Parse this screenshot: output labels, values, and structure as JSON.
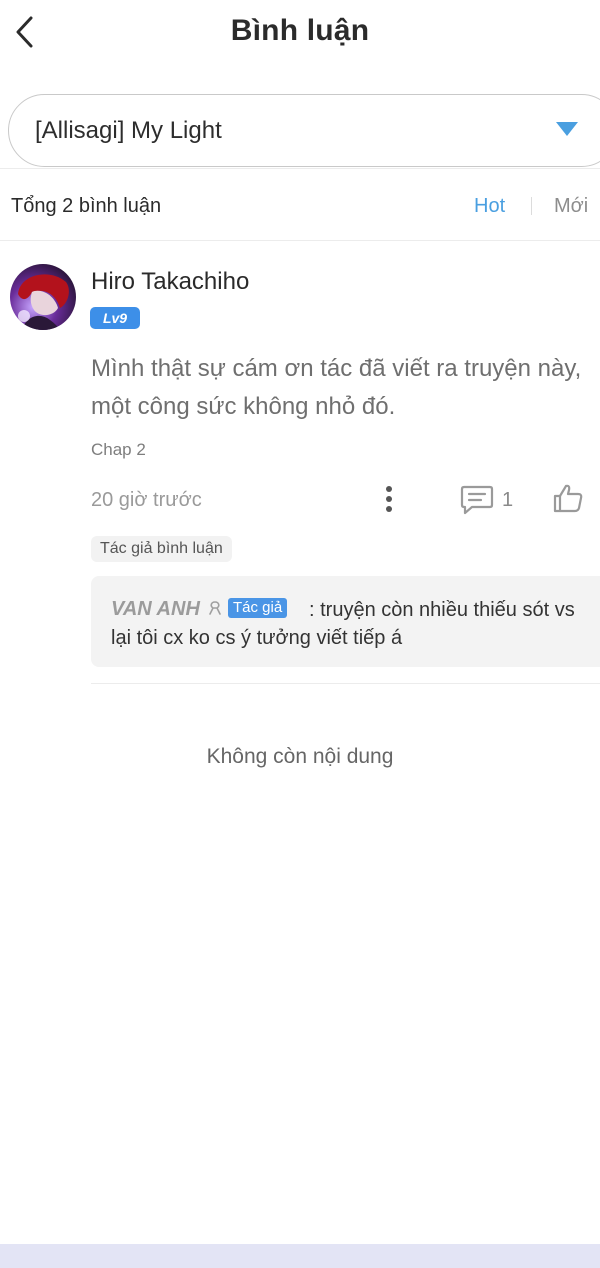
{
  "header": {
    "title": "Bình luận",
    "back_icon": "chevron-left-icon"
  },
  "selector": {
    "value": "[Allisagi] My Light",
    "caret_icon": "caret-down-icon",
    "caret_color": "#4a9fe0"
  },
  "sort": {
    "total_label": "Tổng 2 bình luận",
    "hot_label": "Hot",
    "new_label": "Mới",
    "active": "Hot",
    "active_color": "#4a9fe0"
  },
  "comments": [
    {
      "username": "Hiro Takachiho",
      "level": "Lv9",
      "text_line1": "Mình thật sự cám ơn tác đã viết ra truyện này,",
      "text_line2": "một công sức không nhỏ đó.",
      "chapter": "Chap 2",
      "time": "20 giờ trước",
      "reply_count": "1",
      "author_chip": "Tác giả bình luận",
      "reply": {
        "name": "VAN ANH",
        "name_icon": "ribbon-icon",
        "badge": "Tác giả",
        "text_line1": ": truyện còn nhiều thiếu sót vs",
        "text_line2": "lại tôi cx ko cs ý tưởng viết tiếp á"
      }
    }
  ],
  "footer": {
    "end_text": "Không còn nội dung"
  },
  "colors": {
    "accent": "#4a9fe0",
    "level_badge": "#3d8fe8",
    "bottom_bar": "#e3e4f5"
  }
}
